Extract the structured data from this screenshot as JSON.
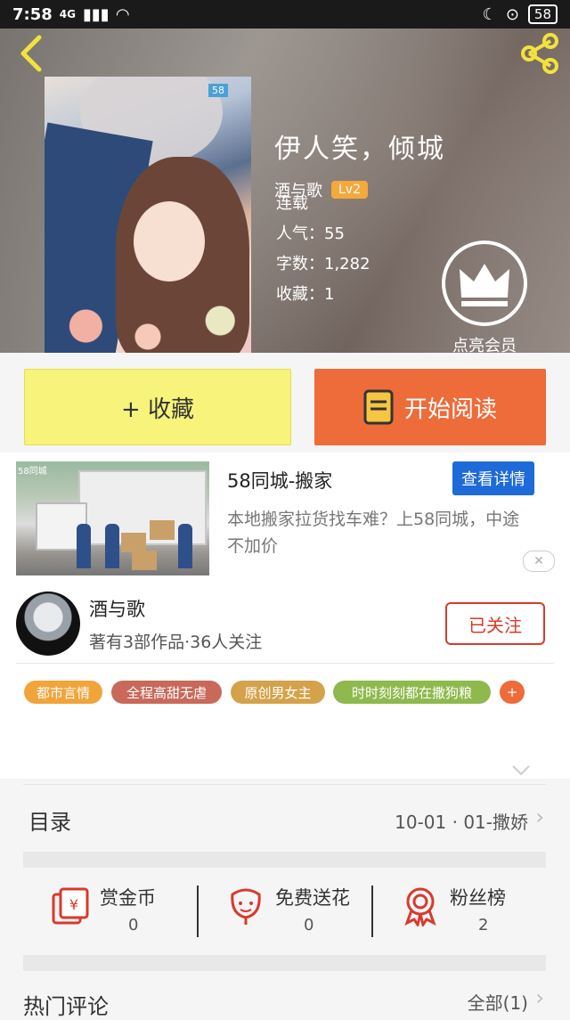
{
  "status_bar": {
    "time": "7:58",
    "network": "4G",
    "battery": "58"
  },
  "book": {
    "title": "伊人笑，倾城",
    "author": "酒与歌",
    "level": "Lv2",
    "status": "连载",
    "popularity_label": "人气：55",
    "words_label": "字数：1,282",
    "favorites_label": "收藏：1",
    "cover_tag": "58"
  },
  "vip": {
    "label": "点亮会员"
  },
  "actions": {
    "collect": "+ 收藏",
    "read": "开始阅读"
  },
  "ad": {
    "title": "58同城-搬家",
    "detail_button": "查看详情",
    "description": "本地搬家拉货找车难？上58同城，中途不加价",
    "image_logo": "58同城",
    "close": "✕"
  },
  "author_card": {
    "name": "酒与歌",
    "subtitle": "著有3部作品·36人关注",
    "follow_button": "已关注"
  },
  "tags": [
    {
      "label": "都市言情",
      "color": "#f0a43a"
    },
    {
      "label": "全程高甜无虐",
      "color": "#c8695a"
    },
    {
      "label": "原创男女主",
      "color": "#d4a24a"
    },
    {
      "label": "时时刻刻都在撒狗粮",
      "color": "#8fb94c"
    },
    {
      "label": "+",
      "color": "#ee6b3a"
    }
  ],
  "toc": {
    "label": "目录",
    "latest": "10-01 · 01-撒娇"
  },
  "stats": [
    {
      "label": "赏金币",
      "value": "0",
      "icon": "gold-envelope-icon"
    },
    {
      "label": "免费送花",
      "value": "0",
      "icon": "flower-icon"
    },
    {
      "label": "粉丝榜",
      "value": "2",
      "icon": "medal-icon"
    }
  ],
  "comments": {
    "label": "热门评论",
    "all": "全部(1)"
  },
  "colors": {
    "accent": "#ee6b3a",
    "collect_bg": "#f8f37a",
    "follow": "#d83a2c",
    "link_blue": "#1e6ad8"
  }
}
